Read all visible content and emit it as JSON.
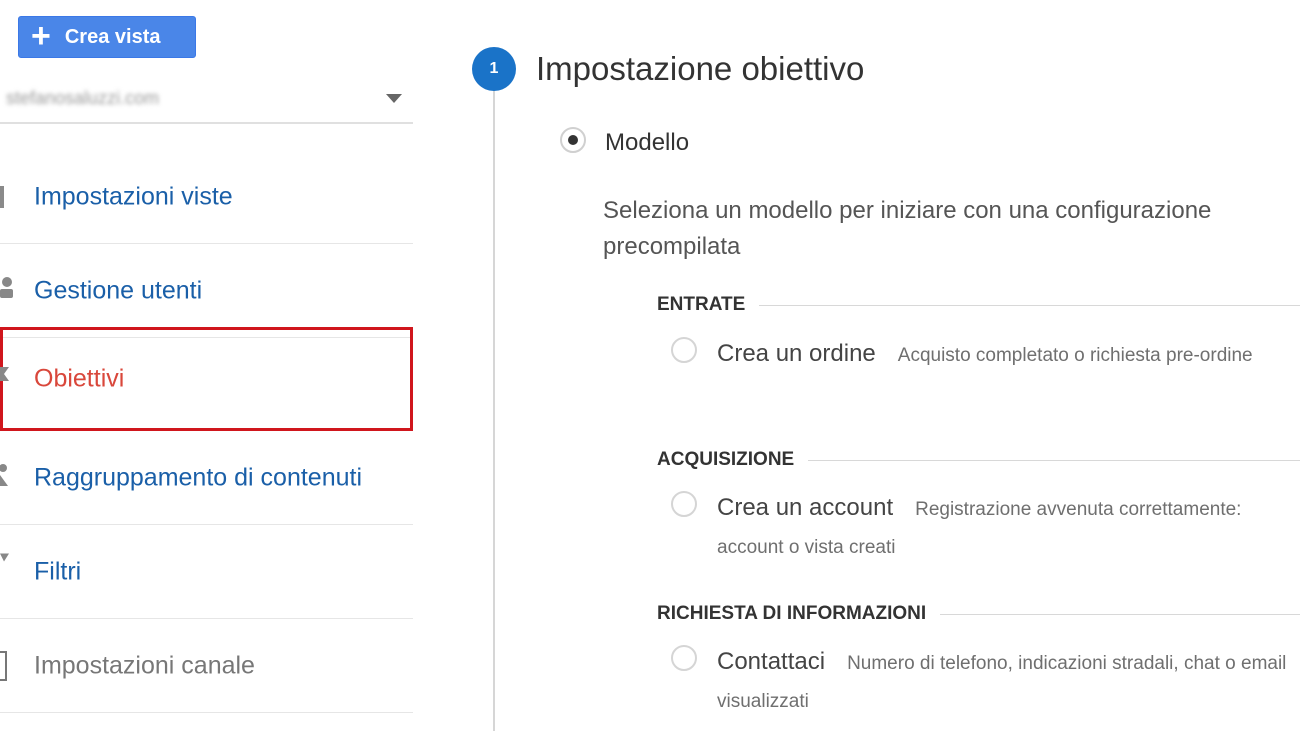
{
  "sidebar": {
    "create_button": "Crea vista",
    "view_select_value": "stefanosaluzzi.com",
    "items": [
      {
        "label": "Impostazioni viste",
        "icon": "document-icon"
      },
      {
        "label": "Gestione utenti",
        "icon": "users-icon"
      },
      {
        "label": "Obiettivi",
        "icon": "flag-icon"
      },
      {
        "label": "Raggruppamento di contenuti",
        "icon": "person-icon"
      },
      {
        "label": "Filtri",
        "icon": "filter-icon"
      },
      {
        "label": "Impostazioni canale",
        "icon": "channel-icon"
      }
    ]
  },
  "main": {
    "step_number": "1",
    "step_title": "Impostazione obiettivo",
    "template_option": "Modello",
    "template_description": "Seleziona un modello per iniziare con una configurazione precompilata",
    "sections": [
      {
        "title": "ENTRATE",
        "options": [
          {
            "name": "Crea un ordine",
            "desc": "Acquisto completato o richiesta pre-ordine"
          }
        ]
      },
      {
        "title": "ACQUISIZIONE",
        "options": [
          {
            "name": "Crea un account",
            "desc": "Registrazione avvenuta correttamente: account o vista creati"
          }
        ]
      },
      {
        "title": "RICHIESTA DI INFORMAZIONI",
        "options": [
          {
            "name": "Contattaci",
            "desc": "Numero di telefono, indicazioni stradali, chat o email visualizzati"
          }
        ]
      }
    ]
  },
  "colors": {
    "accent": "#4a86e8",
    "link": "#1a5fa8",
    "active": "#d9473b",
    "highlight_border": "#d0161d"
  }
}
